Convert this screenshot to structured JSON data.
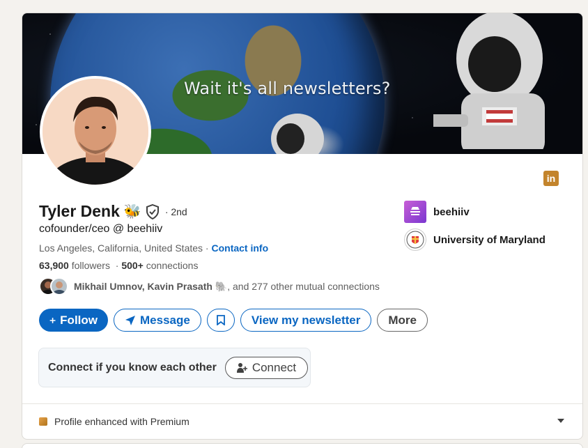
{
  "banner": {
    "text": "Wait it's all newsletters?"
  },
  "profile": {
    "name": "Tyler Denk",
    "name_emoji": "🐝",
    "degree": "· 2nd",
    "headline": "cofounder/ceo @ beehiiv",
    "location": "Los Angeles, California, United States",
    "location_sep": " · ",
    "contact_info": "Contact info",
    "followers_count": "63,900",
    "followers_label": "followers",
    "connections_count": "500+",
    "connections_label": "connections",
    "mutual_names": "Mikhail Umnov, Kavin Prasath",
    "mutual_emoji": "🐘",
    "mutual_rest": ", and 277 other mutual connections"
  },
  "badges": {
    "linkedin": "in"
  },
  "affiliations": [
    {
      "name": "beehiiv",
      "icon": "beehiiv-logo"
    },
    {
      "name": "University of Maryland",
      "icon": "umd-seal-logo"
    }
  ],
  "actions": {
    "follow": "Follow",
    "message": "Message",
    "save_icon": "bookmark-icon",
    "newsletter": "View my newsletter",
    "more": "More"
  },
  "connect_prompt": {
    "text": "Connect if you know each other",
    "button": "Connect"
  },
  "premium": {
    "text": "Profile enhanced with Premium"
  },
  "colors": {
    "accent": "#0a66c2",
    "background": "#f4f2ee",
    "premium": "#c3842c"
  }
}
